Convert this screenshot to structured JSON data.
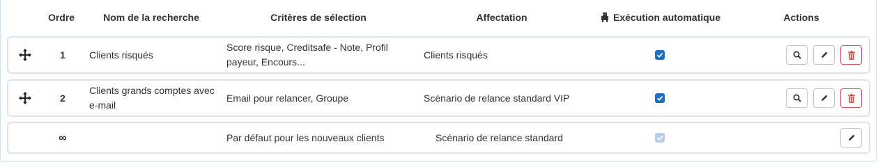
{
  "header": {
    "ordre": "Ordre",
    "nom": "Nom de la recherche",
    "criteres": "Critères de sélection",
    "affectation": "Affectation",
    "execution": "Exécution automatique",
    "actions": "Actions"
  },
  "rows": [
    {
      "order": "1",
      "name": "Clients risqués",
      "criteria": "Score risque, Creditsafe - Note, Profil payeur, Encours...",
      "assignment": "Clients risqués",
      "auto": true
    },
    {
      "order": "2",
      "name": "Clients grands comptes avec e-mail",
      "criteria": "Email pour relancer, Groupe",
      "assignment": "Scénario de relance standard VIP",
      "auto": true
    },
    {
      "order": "∞",
      "name": "",
      "criteria": "Par défaut pour les nouveaux clients",
      "assignment": "Scénario de relance standard",
      "auto": true,
      "auto_disabled": true
    }
  ],
  "colors": {
    "accent": "#1f6fbf",
    "danger": "#d9534f",
    "row_border": "#dde3ea"
  },
  "icons": {
    "drag": "move-arrows-icon",
    "robot": "robot-icon",
    "search": "search-icon",
    "edit": "pencil-icon",
    "delete": "trash-icon"
  }
}
